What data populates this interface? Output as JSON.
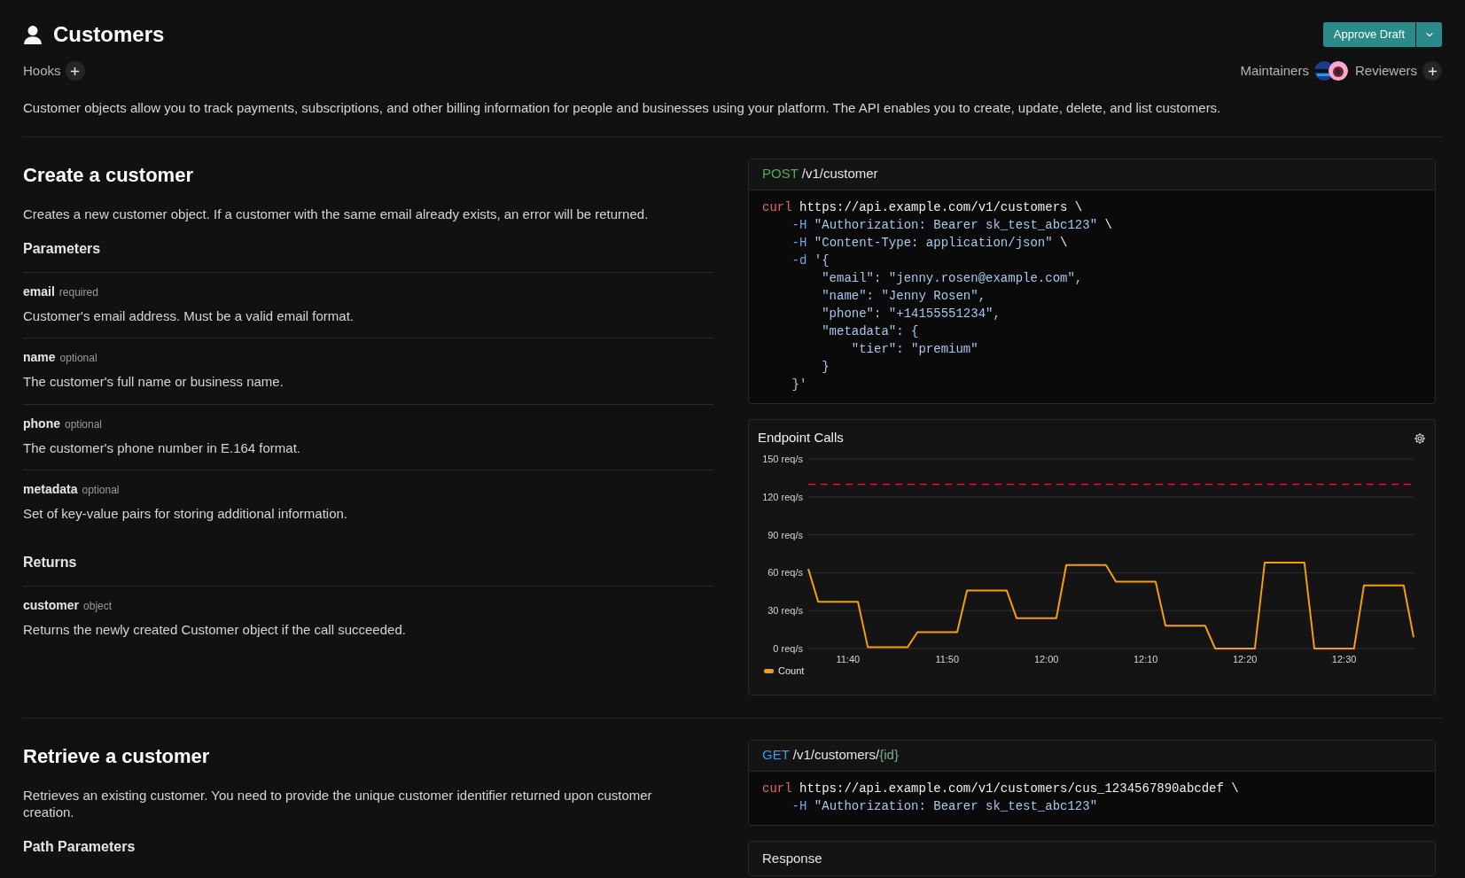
{
  "header": {
    "title": "Customers",
    "hooks_label": "Hooks",
    "approve_button": "Approve Draft",
    "maintainers_label": "Maintainers",
    "reviewers_label": "Reviewers"
  },
  "description": "Customer objects allow you to track payments, subscriptions, and other billing information for people and businesses using your platform. The API enables you to create, update, delete, and list customers.",
  "sections": [
    {
      "title": "Create a customer",
      "description": "Creates a new customer object. If a customer with the same email already exists, an error will be returned.",
      "groups": [
        {
          "heading": "Parameters",
          "params": [
            {
              "name": "email",
              "tag": "required",
              "description": "Customer's email address. Must be a valid email format."
            },
            {
              "name": "name",
              "tag": "optional",
              "description": "The customer's full name or business name."
            },
            {
              "name": "phone",
              "tag": "optional",
              "description": "The customer's phone number in E.164 format."
            },
            {
              "name": "metadata",
              "tag": "optional",
              "description": "Set of key-value pairs for storing additional information."
            }
          ]
        },
        {
          "heading": "Returns",
          "params": [
            {
              "name": "customer",
              "tag": "object",
              "description": "Returns the newly created Customer object if the call succeeded."
            }
          ]
        }
      ],
      "endpoint": {
        "method": "POST",
        "kind": "post",
        "path": [
          {
            "kind": "path",
            "text": "/v1/customer"
          }
        ]
      },
      "code": [
        [
          {
            "kind": "cmd",
            "text": "curl"
          },
          {
            "kind": "plain",
            "text": " https://api.example.com/v1/customers \\"
          }
        ],
        [
          {
            "kind": "flag",
            "text": "    -H"
          },
          {
            "kind": "str",
            "text": " \"Authorization: Bearer sk_test_abc123\""
          },
          {
            "kind": "plain",
            "text": " \\"
          }
        ],
        [
          {
            "kind": "flag",
            "text": "    -H"
          },
          {
            "kind": "str",
            "text": " \"Content-Type: application/json\""
          },
          {
            "kind": "plain",
            "text": " \\"
          }
        ],
        [
          {
            "kind": "flag",
            "text": "    -d"
          },
          {
            "kind": "str",
            "text": " '{"
          }
        ],
        [
          {
            "kind": "str",
            "text": "        \"email\": \"jenny.rosen@example.com\","
          }
        ],
        [
          {
            "kind": "str",
            "text": "        \"name\": \"Jenny Rosen\","
          }
        ],
        [
          {
            "kind": "str",
            "text": "        \"phone\": \"+14155551234\","
          }
        ],
        [
          {
            "kind": "str",
            "text": "        \"metadata\": {"
          }
        ],
        [
          {
            "kind": "str",
            "text": "            \"tier\": \"premium\""
          }
        ],
        [
          {
            "kind": "str",
            "text": "        }"
          }
        ],
        [
          {
            "kind": "str",
            "text": "    }'"
          }
        ]
      ],
      "chart": {
        "title": "Endpoint Calls",
        "chart_data": {
          "type": "line",
          "categories": [
            null,
            null,
            null,
            null,
            "11:40",
            null,
            null,
            null,
            null,
            null,
            null,
            null,
            null,
            null,
            "11:50",
            null,
            null,
            null,
            null,
            null,
            null,
            null,
            null,
            null,
            "12:00",
            null,
            null,
            null,
            null,
            null,
            null,
            null,
            null,
            null,
            "12:10",
            null,
            null,
            null,
            null,
            null,
            null,
            null,
            null,
            null,
            "12:20",
            null,
            null,
            null,
            null,
            null,
            null,
            null,
            null,
            null,
            "12:30",
            null,
            null,
            null,
            null,
            null,
            null,
            null
          ],
          "series": [
            {
              "name": "Count",
              "color": "#f59e0b",
              "values": [
                63,
                37,
                37,
                37,
                37,
                37,
                1,
                1,
                1,
                1,
                1,
                13,
                13,
                13,
                13,
                13,
                46,
                46,
                46,
                46,
                46,
                24,
                24,
                24,
                24,
                24,
                66,
                66,
                66,
                66,
                66,
                53,
                53,
                53,
                53,
                53,
                18,
                18,
                18,
                18,
                18,
                0,
                0,
                0,
                0,
                0,
                68,
                68,
                68,
                68,
                68,
                0,
                0,
                0,
                0,
                0,
                50,
                50,
                50,
                50,
                50,
                9
              ]
            }
          ],
          "ylim": [
            0,
            150
          ],
          "yticks": [
            {
              "value": 0,
              "label": "0 req/s"
            },
            {
              "value": 30,
              "label": "30 req/s"
            },
            {
              "value": 60,
              "label": "60 req/s"
            },
            {
              "value": 90,
              "label": "90 req/s"
            },
            {
              "value": 120,
              "label": "120 req/s"
            },
            {
              "value": 150,
              "label": "150 req/s"
            }
          ],
          "grid": true,
          "ref_lines": [
            {
              "axis": "y",
              "value": 130,
              "color": "#dc2626"
            }
          ]
        }
      }
    },
    {
      "title": "Retrieve a customer",
      "description": "Retrieves an existing customer. You need to provide the unique customer identifier returned upon customer creation.",
      "groups": [
        {
          "heading": "Path Parameters"
        }
      ],
      "endpoint": {
        "method": "GET",
        "kind": "get",
        "path": [
          {
            "kind": "path",
            "text": "/v1/customers/"
          },
          {
            "kind": "param",
            "text": "{id}"
          }
        ]
      },
      "code": [
        [
          {
            "kind": "cmd",
            "text": "curl"
          },
          {
            "kind": "plain",
            "text": " https://api.example.com/v1/customers/cus_1234567890abcdef \\"
          }
        ],
        [
          {
            "kind": "flag",
            "text": "    -H"
          },
          {
            "kind": "str",
            "text": " \"Authorization: Bearer sk_test_abc123\""
          }
        ]
      ],
      "response": {
        "title": "Response"
      }
    }
  ]
}
